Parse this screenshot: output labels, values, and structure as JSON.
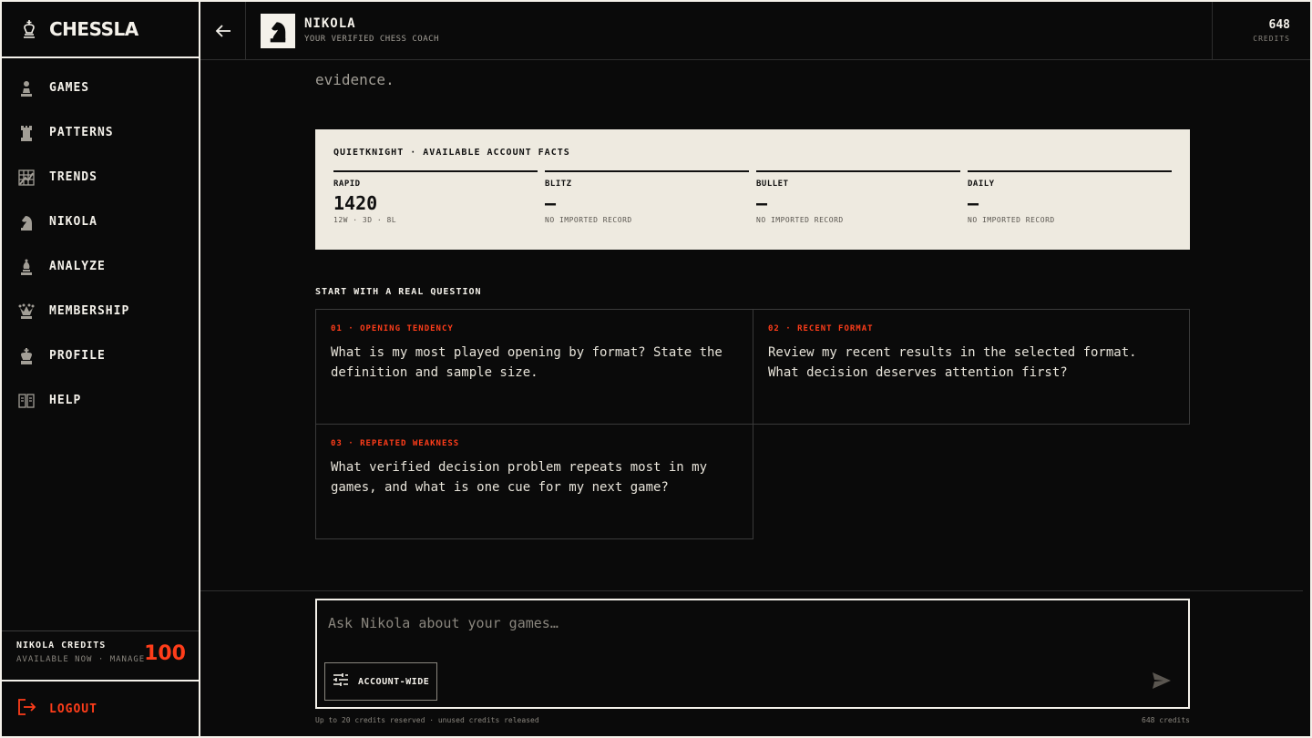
{
  "brand": {
    "name": "CHESSLA"
  },
  "sidebar": {
    "items": [
      {
        "label": "GAMES",
        "icon": "pawn-icon"
      },
      {
        "label": "PATTERNS",
        "icon": "rook-icon"
      },
      {
        "label": "TRENDS",
        "icon": "grid-chart-icon"
      },
      {
        "label": "NIKOLA",
        "icon": "knight-icon"
      },
      {
        "label": "ANALYZE",
        "icon": "bishop-icon"
      },
      {
        "label": "MEMBERSHIP",
        "icon": "queen-icon"
      },
      {
        "label": "PROFILE",
        "icon": "king-icon"
      },
      {
        "label": "HELP",
        "icon": "book-icon"
      }
    ],
    "credits": {
      "title": "NIKOLA CREDITS",
      "subtitle": "AVAILABLE NOW · MANAGE",
      "value": "100"
    },
    "logout": "LOGOUT"
  },
  "header": {
    "coach_name": "NIKOLA",
    "coach_subtitle": "YOUR VERIFIED CHESS COACH",
    "credits_value": "648",
    "credits_label": "CREDITS"
  },
  "main": {
    "fade_text": "evidence.",
    "facts": {
      "title": "QUIETKNIGHT · AVAILABLE ACCOUNT FACTS",
      "items": [
        {
          "key": "RAPID",
          "value": "1420",
          "sub": "12W · 3D · 8L"
        },
        {
          "key": "BLITZ",
          "value": "—",
          "sub": "NO IMPORTED RECORD"
        },
        {
          "key": "BULLET",
          "value": "—",
          "sub": "NO IMPORTED RECORD"
        },
        {
          "key": "DAILY",
          "value": "—",
          "sub": "NO IMPORTED RECORD"
        }
      ]
    },
    "questions_heading": "START WITH A REAL QUESTION",
    "questions": [
      {
        "tag": "01 · OPENING TENDENCY",
        "text": "What is my most played opening by format? State the definition and sample size."
      },
      {
        "tag": "02 · RECENT FORMAT",
        "text": "Review my recent results in the selected format. What decision deserves attention first?"
      },
      {
        "tag": "03 · REPEATED WEAKNESS",
        "text": "What verified decision problem repeats most in my games, and what is one cue for my next game?"
      }
    ]
  },
  "composer": {
    "placeholder": "Ask Nikola about your games…",
    "scope_label": "ACCOUNT-WIDE",
    "footer_left": "Up to 20 credits reserved · unused credits released",
    "footer_right": "648 credits"
  },
  "colors": {
    "accent": "#ff3d1a",
    "background": "#0a0a0a",
    "panel": "#eeeae0"
  }
}
